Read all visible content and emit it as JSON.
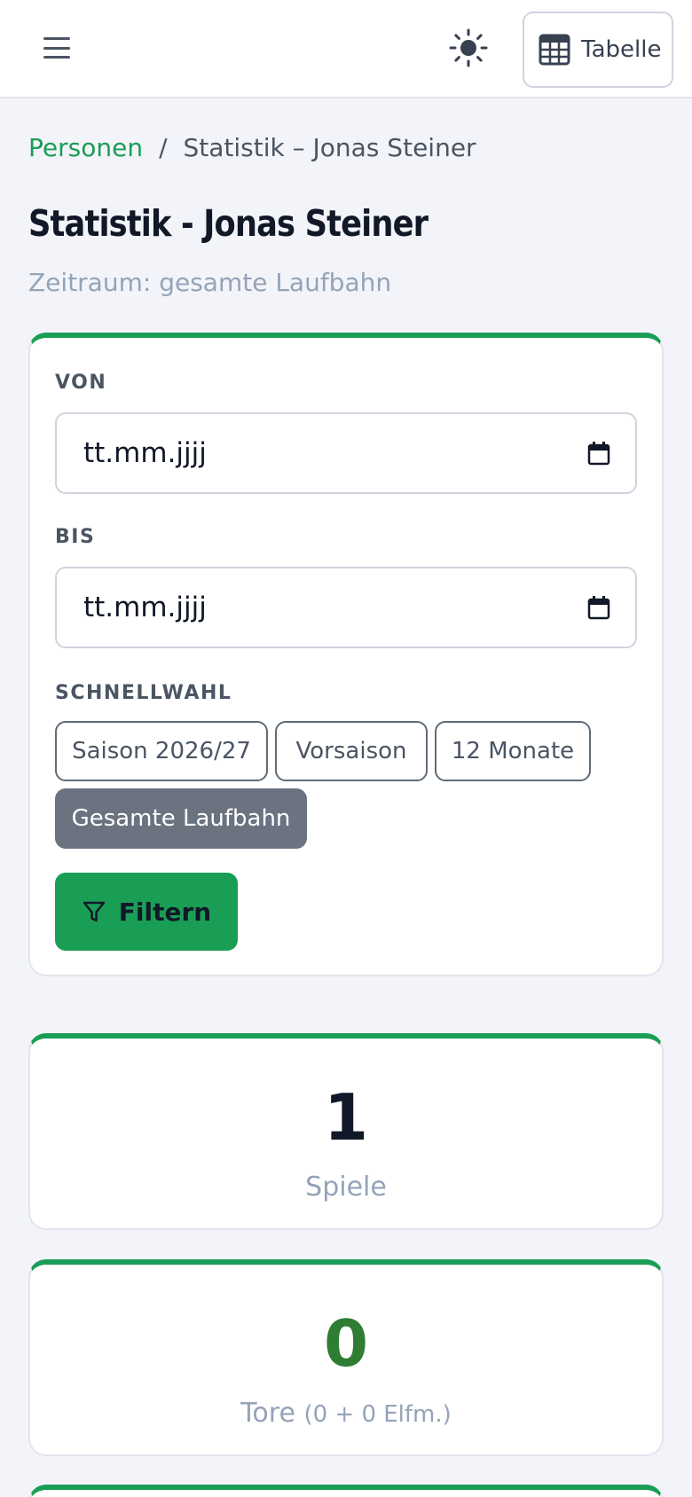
{
  "header": {
    "table_button_label": "Tabelle",
    "icons": {
      "menu": "hamburger-icon",
      "theme": "sun-icon",
      "table": "table-grid-icon"
    }
  },
  "breadcrumb": {
    "parent": "Personen",
    "separator": "/",
    "current": "Statistik – Jonas Steiner"
  },
  "page": {
    "title": "Statistik - Jonas Steiner",
    "subtitle": "Zeitraum: gesamte Laufbahn"
  },
  "filter": {
    "from_label": "VON",
    "from_value": "tt.mm.jjjj",
    "to_label": "BIS",
    "to_value": "tt.mm.jjjj",
    "quick_label": "SCHNELLWAHL",
    "quick_options": [
      "Saison 2026/27",
      "Vorsaison",
      "12 Monate",
      "Gesamte Laufbahn"
    ],
    "quick_selected": "Gesamte Laufbahn",
    "submit_label": "Filtern"
  },
  "stats": {
    "games_value": "1",
    "games_label": "Spiele",
    "goals_value": "0",
    "goals_label": "Tore",
    "goals_detail": "(0 + 0 Elfm.)"
  },
  "colors": {
    "accent": "#1a9e56",
    "goals_value": "#2e7d32",
    "chip_active": "#6b7280",
    "muted_text": "#94a3b8"
  }
}
